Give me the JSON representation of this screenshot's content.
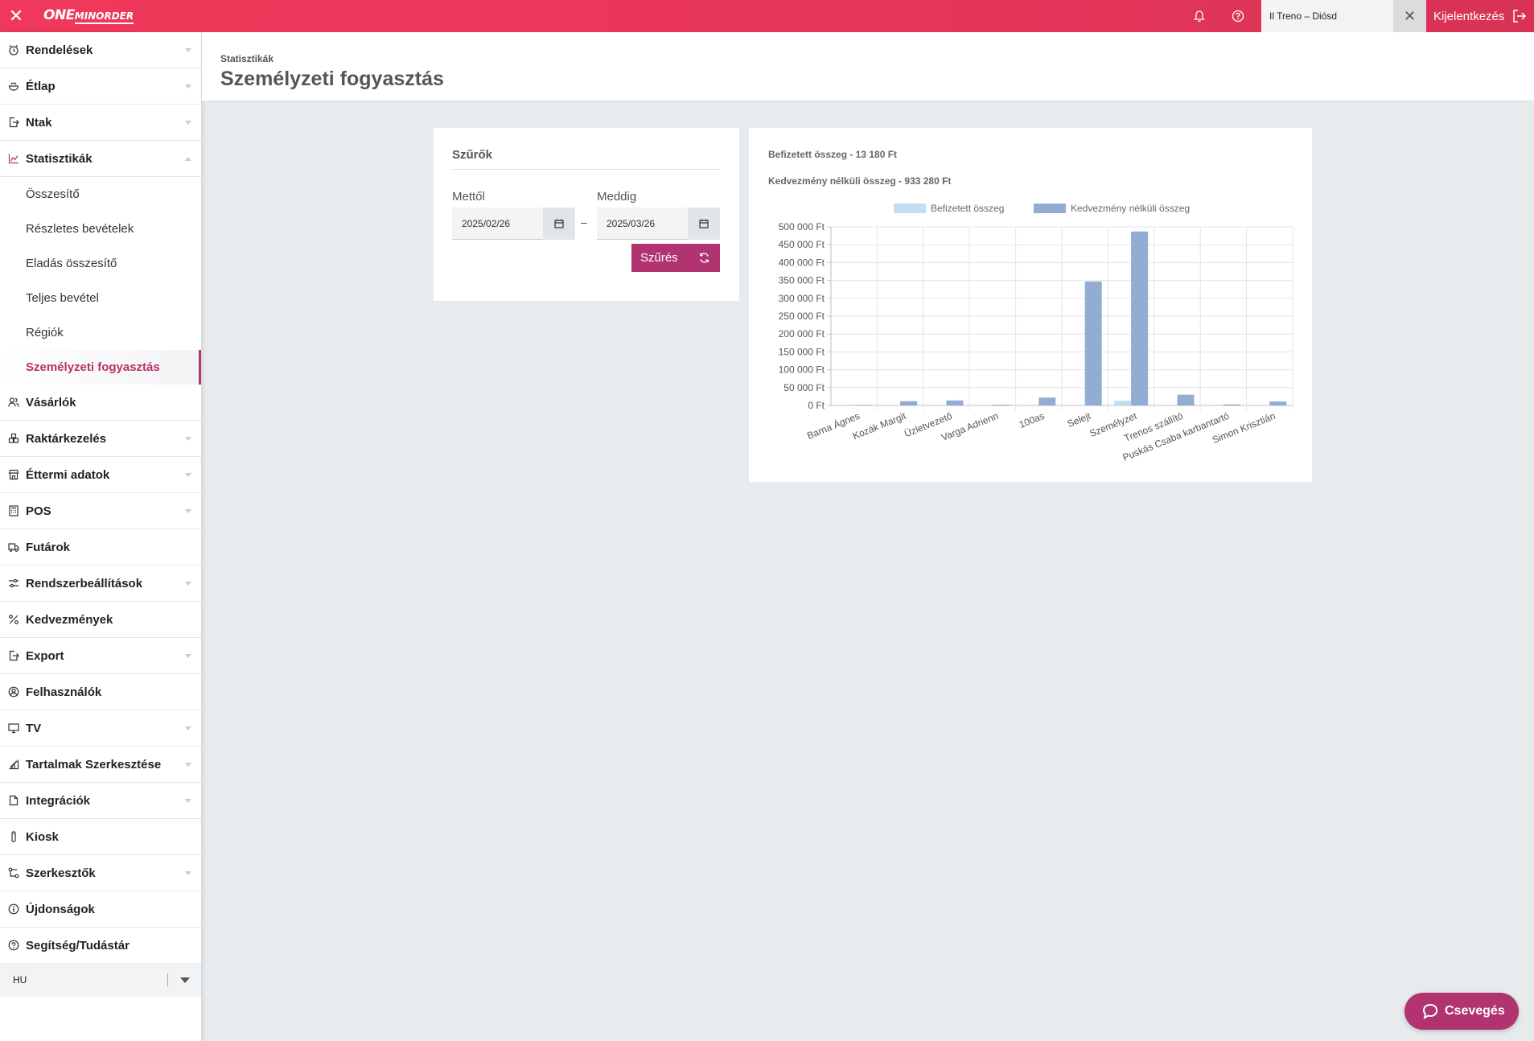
{
  "topbar": {
    "logo_main": "ONE",
    "logo_sub": "MINORDER",
    "restaurant": "Il Treno – Diósd",
    "logout_label": "Kijelentkezés"
  },
  "sidebar": {
    "items": [
      {
        "label": "Rendelések",
        "icon": "alarm-clock-icon",
        "caret": "down"
      },
      {
        "label": "Étlap",
        "icon": "bowl-icon",
        "caret": "down"
      },
      {
        "label": "Ntak",
        "icon": "document-export-icon",
        "caret": "down"
      },
      {
        "label": "Statisztikák",
        "icon": "chart-line-icon",
        "caret": "up",
        "open": true
      }
    ],
    "sub_items": [
      {
        "label": "Összesítő"
      },
      {
        "label": "Részletes bevételek"
      },
      {
        "label": "Eladás összesítő"
      },
      {
        "label": "Teljes bevétel"
      },
      {
        "label": "Régiók"
      },
      {
        "label": "Személyzeti fogyasztás",
        "active": true
      }
    ],
    "items_after": [
      {
        "label": "Vásárlók",
        "icon": "users-icon",
        "caret": "none"
      },
      {
        "label": "Raktárkezelés",
        "icon": "boxes-icon",
        "caret": "down"
      },
      {
        "label": "Éttermi adatok",
        "icon": "store-icon",
        "caret": "down"
      },
      {
        "label": "POS",
        "icon": "calculator-icon",
        "caret": "down"
      },
      {
        "label": "Futárok",
        "icon": "delivery-truck-icon",
        "caret": "none"
      },
      {
        "label": "Rendszerbeállítások",
        "icon": "sliders-icon",
        "caret": "down"
      },
      {
        "label": "Kedvezmények",
        "icon": "percent-icon",
        "caret": "none"
      },
      {
        "label": "Export",
        "icon": "file-export-icon",
        "caret": "down"
      },
      {
        "label": "Felhasználók",
        "icon": "user-circle-icon",
        "caret": "none"
      },
      {
        "label": "TV",
        "icon": "monitor-icon",
        "caret": "down"
      },
      {
        "label": "Tartalmak Szerkesztése",
        "icon": "edit-chart-icon",
        "caret": "down"
      },
      {
        "label": "Integrációk",
        "icon": "document-icon",
        "caret": "down"
      },
      {
        "label": "Kiosk",
        "icon": "kiosk-icon",
        "caret": "none"
      },
      {
        "label": "Szerkesztők",
        "icon": "nodes-icon",
        "caret": "down"
      },
      {
        "label": "Újdonságok",
        "icon": "info-icon",
        "caret": "none"
      },
      {
        "label": "Segítség/Tudástár",
        "icon": "help-icon",
        "caret": "none"
      }
    ],
    "language": "HU"
  },
  "header": {
    "breadcrumb": "Statisztikák",
    "title": "Személyzeti fogyasztás"
  },
  "filters": {
    "title": "Szűrők",
    "from_label": "Mettől",
    "from_value": "2025/02/26",
    "to_label": "Meddig",
    "to_value": "2025/03/26",
    "separator": "–",
    "button_label": "Szűrés"
  },
  "summary": {
    "paid": "Befizetett összeg - 13 180 Ft",
    "undiscounted": "Kedvezmény nélküli összeg - 933 280 Ft"
  },
  "chat": {
    "label": "Csevegés"
  },
  "chart_data": {
    "type": "bar",
    "categories": [
      "Barna Ágnes",
      "Kozák Margit",
      "Üzletvezető",
      "Varga Adrienn",
      "100as",
      "Selejt",
      "Személyzet",
      "Trenos szállító",
      "Puskás Csaba karbantartó",
      "Simon Krisztián"
    ],
    "series": [
      {
        "name": "Befizetett összeg",
        "color": "#c2dcf0",
        "values": [
          0,
          0,
          0,
          0,
          0,
          0,
          13180,
          0,
          0,
          0
        ]
      },
      {
        "name": "Kedvezmény nélküli összeg",
        "color": "#93acd4",
        "values": [
          1500,
          12000,
          14000,
          2000,
          22000,
          347000,
          487000,
          30000,
          3000,
          11000
        ]
      }
    ],
    "ylim": [
      0,
      500000
    ],
    "yticks": [
      0,
      50000,
      100000,
      150000,
      200000,
      250000,
      300000,
      350000,
      400000,
      450000,
      500000
    ],
    "ytick_labels": [
      "0 Ft",
      "50 000 Ft",
      "100 000 Ft",
      "150 000 Ft",
      "200 000 Ft",
      "250 000 Ft",
      "300 000 Ft",
      "350 000 Ft",
      "400 000 Ft",
      "450 000 Ft",
      "500 000 Ft"
    ],
    "grid": true,
    "legend": "top-center"
  }
}
